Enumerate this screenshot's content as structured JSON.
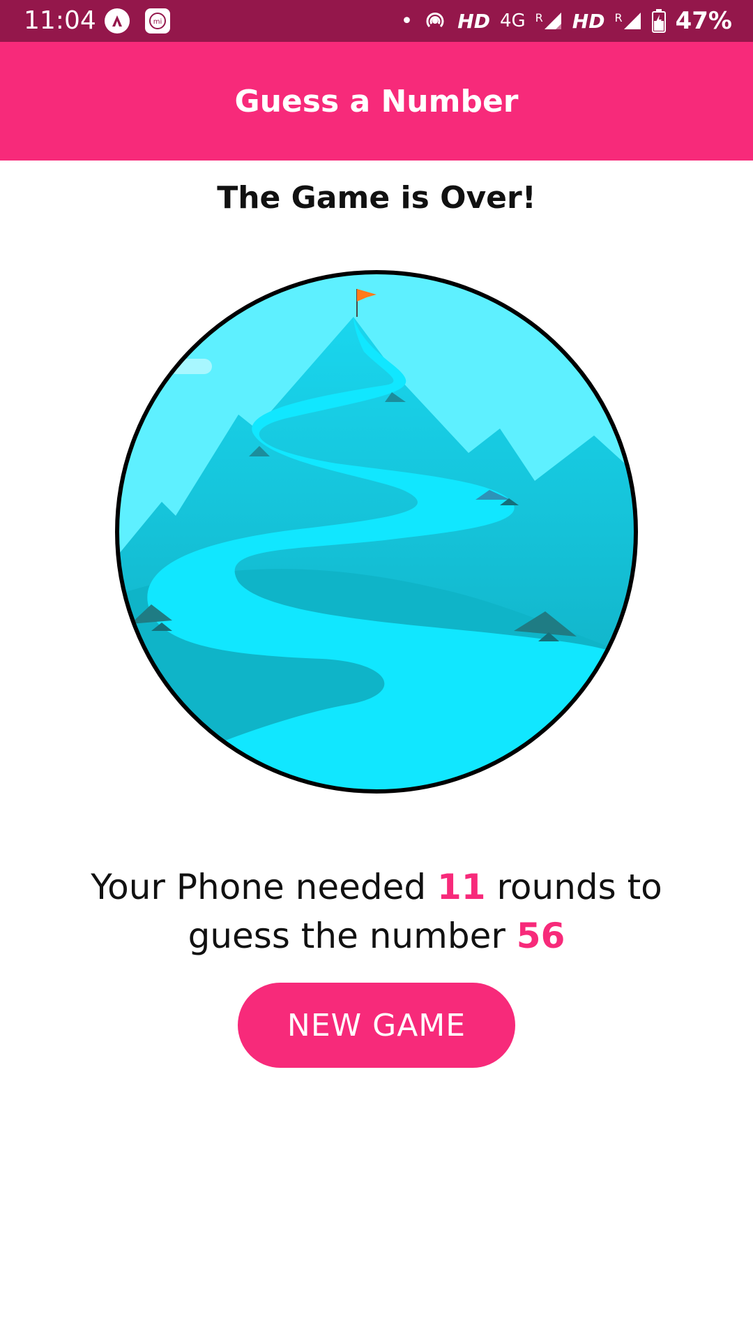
{
  "status_bar": {
    "time": "11:04",
    "signal_1_label": "HD",
    "network_type": "4G",
    "roaming_1": "R",
    "signal_2_label": "HD",
    "roaming_2": "R",
    "battery_percent": "47%"
  },
  "app_bar": {
    "title": "Guess a Number"
  },
  "game_over": {
    "title": "The Game is Over!"
  },
  "result": {
    "prefix": "Your Phone needed ",
    "rounds": "11",
    "middle": " rounds to guess the number ",
    "number": "56"
  },
  "actions": {
    "new_game_label": "NEW GAME"
  },
  "colors": {
    "status_bar": "#94174b",
    "primary": "#f72a7a",
    "sky": "#5ef0ff",
    "river": "#11e7ff",
    "flag": "#ff7a1a"
  }
}
